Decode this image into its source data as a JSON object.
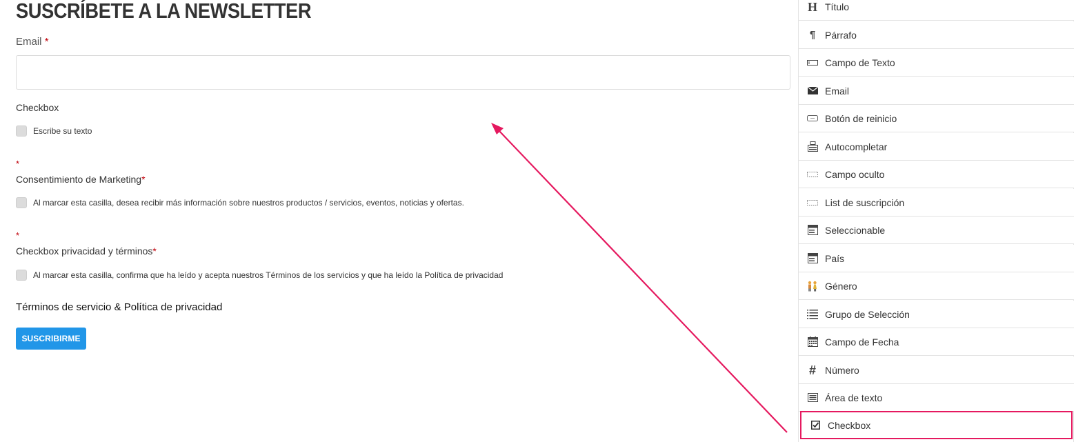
{
  "form": {
    "title": "SUSCRÍBETE A LA NEWSLETTER",
    "email_label": "Email",
    "required_mark": "*",
    "email_value": "",
    "email_placeholder": "",
    "checkbox_group_label": "Checkbox",
    "checkbox_option": "Escribe su texto",
    "marketing_label": "Consentimiento de Marketing",
    "marketing_text": "Al marcar esta casilla, desea recibir más información sobre nuestros productos / servicios, eventos, noticias y ofertas.",
    "privacy_label": "Checkbox privacidad y términos",
    "privacy_text": "Al marcar esta casilla, confirma que ha leído y acepta nuestros Términos de los servicios y que ha leído la Política de privacidad",
    "terms_a": "Términos de servicio",
    "terms_amp": "&",
    "terms_b": "Política de privacidad",
    "submit_label": "SUSCRIBIRME"
  },
  "panel": {
    "items": [
      {
        "label": "Título",
        "icon": "heading-icon"
      },
      {
        "label": "Párrafo",
        "icon": "paragraph-icon"
      },
      {
        "label": "Campo de Texto",
        "icon": "text-field-icon"
      },
      {
        "label": "Email",
        "icon": "envelope-icon"
      },
      {
        "label": "Botón de reinicio",
        "icon": "reset-button-icon"
      },
      {
        "label": "Autocompletar",
        "icon": "autocomplete-icon"
      },
      {
        "label": "Campo oculto",
        "icon": "hidden-field-icon"
      },
      {
        "label": "List de suscripción",
        "icon": "subscription-list-icon"
      },
      {
        "label": "Seleccionable",
        "icon": "select-icon"
      },
      {
        "label": "País",
        "icon": "country-icon"
      },
      {
        "label": "Género",
        "icon": "gender-icon"
      },
      {
        "label": "Grupo de Selección",
        "icon": "list-group-icon"
      },
      {
        "label": "Campo de Fecha",
        "icon": "calendar-icon"
      },
      {
        "label": "Número",
        "icon": "hash-icon"
      },
      {
        "label": "Área de texto",
        "icon": "textarea-icon"
      },
      {
        "label": "Checkbox",
        "icon": "checkbox-icon",
        "highlighted": true
      }
    ]
  },
  "colors": {
    "accent": "#2196e8",
    "required": "#c0000a",
    "highlight": "#e5195f"
  }
}
